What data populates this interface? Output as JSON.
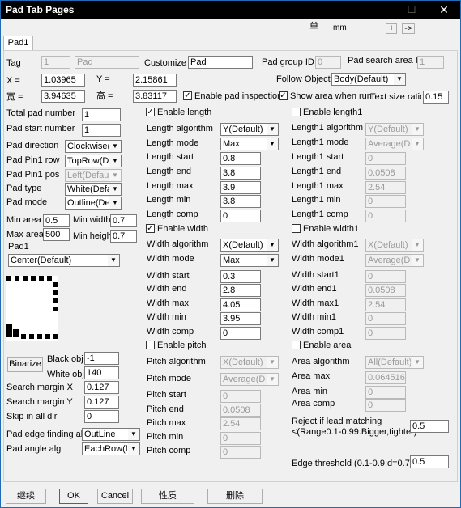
{
  "window": {
    "title": "Pad Tab Pages",
    "min": "—",
    "max": "☐",
    "close": "✕"
  },
  "unit": {
    "label": "单",
    "value": "mm"
  },
  "zoom": {
    "plus": "+",
    "arrow": "->"
  },
  "tab": {
    "label": "Pad1"
  },
  "top": {
    "tag_label": "Tag",
    "tag_value": "1",
    "tag_name": "Pad",
    "customize_label": "Customize",
    "customize_value": "Pad",
    "group_label": "Pad group ID",
    "group_value": "0",
    "search_label": "Pad search area ID",
    "search_value": "1",
    "x_label": "X =",
    "x_value": "1.03965",
    "y_label": "Y =",
    "y_value": "2.15861",
    "follow_label": "Follow Object",
    "follow_value": "Body(Default)",
    "w_label": "宽 =",
    "w_value": "3.94635",
    "h_label": "高 =",
    "h_value": "3.83117",
    "enable_inspection": "Enable pad inspection",
    "show_area": "Show area when run",
    "text_size_label": "Text size ratio",
    "text_size_value": "0.15"
  },
  "left": {
    "total_label": "Total pad number",
    "total_value": "1",
    "start_label": "Pad start number",
    "start_value": "1",
    "direction_label": "Pad direction",
    "direction_value": "Clockwise(De",
    "pin1row_label": "Pad Pin1 row",
    "pin1row_value": "TopRow(Def",
    "pin1pos_label": "Pad Pin1 pos",
    "pin1pos_value": "Left(Default)",
    "type_label": "Pad type",
    "type_value": "White(Defau",
    "mode_label": "Pad mode",
    "mode_value": "Outline(Defa",
    "minarea_label": "Min area",
    "minarea_value": "0.5",
    "minwidth_label": "Min width",
    "minwidth_value": "0.7",
    "maxarea_label": "Max area",
    "maxarea_value": "500",
    "minheight_label": "Min height",
    "minheight_value": "0.7",
    "pad1_label": "Pad1",
    "pad1_value": "Center(Default)",
    "binarize": "Binarize",
    "black_label": "Black obj",
    "black_value": "-1",
    "white_label": "White obj",
    "white_value": "140",
    "smx_label": "Search margin X",
    "smx_value": "0.127",
    "smy_label": "Search margin Y",
    "smy_value": "0.127",
    "skip_label": "Skip in all dir",
    "skip_value": "0",
    "edge_label": "Pad edge finding alg",
    "edge_value": "OutLine",
    "angle_label": "Pad angle alg",
    "angle_value": "EachRow(De"
  },
  "mid": {
    "enable_length": "Enable length",
    "len_alg_label": "Length algorithm",
    "len_alg_value": "Y(Default)",
    "len_mode_label": "Length mode",
    "len_mode_value": "Max",
    "len_start_label": "Length start",
    "len_start_value": "0.8",
    "len_end_label": "Length end",
    "len_end_value": "3.8",
    "len_max_label": "Length max",
    "len_max_value": "3.9",
    "len_min_label": "Length min",
    "len_min_value": "3.8",
    "len_comp_label": "Length comp",
    "len_comp_value": "0",
    "enable_width": "Enable width",
    "wid_alg_label": "Width algorithm",
    "wid_alg_value": "X(Default)",
    "wid_mode_label": "Width mode",
    "wid_mode_value": "Max",
    "wid_start_label": "Width start",
    "wid_start_value": "0.3",
    "wid_end_label": "Width end",
    "wid_end_value": "2.8",
    "wid_max_label": "Width max",
    "wid_max_value": "4.05",
    "wid_min_label": "Width min",
    "wid_min_value": "3.95",
    "wid_comp_label": "Width comp",
    "wid_comp_value": "0",
    "enable_pitch": "Enable pitch",
    "pit_alg_label": "Pitch algorithm",
    "pit_alg_value": "X(Default)",
    "pit_mode_label": "Pitch mode",
    "pit_mode_value": "Average(Def",
    "pit_start_label": "Pitch start",
    "pit_start_value": "0",
    "pit_end_label": "Pitch end",
    "pit_end_value": "0.0508",
    "pit_max_label": "Pitch max",
    "pit_max_value": "2.54",
    "pit_min_label": "Pitch min",
    "pit_min_value": "0",
    "pit_comp_label": "Pitch comp",
    "pit_comp_value": "0"
  },
  "right": {
    "enable_length1": "Enable length1",
    "l1_alg_label": "Length1 algorithm",
    "l1_alg_value": "Y(Default)",
    "l1_mode_label": "Length1 mode",
    "l1_mode_value": "Average(Def",
    "l1_start_label": "Length1 start",
    "l1_start_value": "0",
    "l1_end_label": "Length1 end",
    "l1_end_value": "0.0508",
    "l1_max_label": "Length1 max",
    "l1_max_value": "2.54",
    "l1_min_label": "Length1 min",
    "l1_min_value": "0",
    "l1_comp_label": "Length1 comp",
    "l1_comp_value": "0",
    "enable_width1": "Enable width1",
    "w1_alg_label": "Width algorithm1",
    "w1_alg_value": "X(Default)",
    "w1_mode_label": "Width mode1",
    "w1_mode_value": "Average(Def",
    "w1_start_label": "Width start1",
    "w1_start_value": "0",
    "w1_end_label": "Width end1",
    "w1_end_value": "0.0508",
    "w1_max_label": "Width max1",
    "w1_max_value": "2.54",
    "w1_min_label": "Width min1",
    "w1_min_value": "0",
    "w1_comp_label": "Width comp1",
    "w1_comp_value": "0",
    "enable_area": "Enable area",
    "a_alg_label": "Area algorithm",
    "a_alg_value": "All(Default)",
    "a_max_label": "Area max",
    "a_max_value": "0.064516",
    "a_min_label": "Area min",
    "a_min_value": "0",
    "a_comp_label": "Area comp",
    "a_comp_value": "0",
    "reject_label1": "Reject if lead matching",
    "reject_label2": "<(Range0.1-0.99.Bigger,tighter)",
    "reject_value": "0.5",
    "edge_thr_label": "Edge threshold (0.1-0.9;d=0.7)",
    "edge_thr_value": "0.5"
  },
  "buttons": {
    "continue": "继续",
    "ok": "OK",
    "cancel": "Cancel",
    "props": "性质",
    "delete": "删除"
  }
}
